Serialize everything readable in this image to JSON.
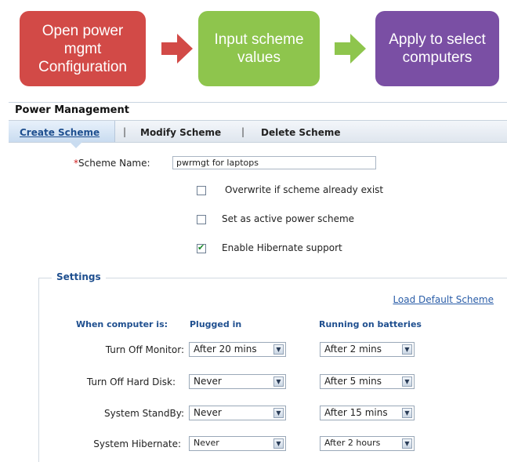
{
  "flow": {
    "steps": [
      {
        "label": "Open power\nmgmt\nConfiguration",
        "color": "#d24a47"
      },
      {
        "label": "Input scheme\nvalues",
        "color": "#8ec54d"
      },
      {
        "label": "Apply to select\ncomputers",
        "color": "#7a4fa4"
      }
    ],
    "arrows": [
      {
        "icon": "arrow-right-icon",
        "color": "#d24a47"
      },
      {
        "icon": "arrow-right-icon",
        "color": "#8ec54d"
      }
    ]
  },
  "panel": {
    "title": "Power Management",
    "tabs": {
      "create": "Create Scheme",
      "modify": "Modify Scheme",
      "delete": "Delete Scheme",
      "separator": "|"
    },
    "scheme_name_label": "Scheme Name:",
    "required_mark": "*",
    "scheme_name_value": "pwrmgt for laptops",
    "options": [
      {
        "label": "Overwrite if scheme already exist",
        "checked": false
      },
      {
        "label": "Set as active power scheme",
        "checked": false
      },
      {
        "label": "Enable Hibernate support",
        "checked": true
      }
    ],
    "check_glyph": "✔"
  },
  "settings": {
    "title": "Settings",
    "load_default": "Load Default Scheme",
    "col_when": "When computer is:",
    "col_plugged": "Plugged in",
    "col_batteries": "Running on batteries",
    "rows": [
      {
        "label": "Turn Off Monitor:",
        "plugged": "After 20 mins",
        "batteries": "After 2 mins"
      },
      {
        "label": "Turn Off Hard Disk:",
        "plugged": "Never",
        "batteries": "After 5 mins"
      },
      {
        "label": "System StandBy:",
        "plugged": "Never",
        "batteries": "After 15 mins"
      },
      {
        "label": "System Hibernate:",
        "plugged": "Never",
        "batteries": "After 2 hours"
      }
    ],
    "dropdown_glyph": "▼"
  }
}
